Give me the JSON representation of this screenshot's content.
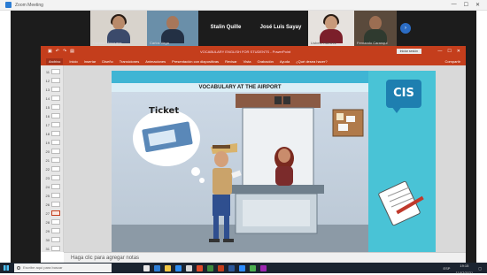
{
  "window": {
    "title": "Zoom Meeting"
  },
  "participants": [
    {
      "name": "Daniela Mosquera",
      "video": true,
      "shirt": "#3b4a6b"
    },
    {
      "name": "Carlos Vega",
      "video": true,
      "shirt": "#233044"
    },
    {
      "name": "Stalin Quille",
      "video": false
    },
    {
      "name": "José Luis Sayay",
      "video": false
    },
    {
      "name": "Lisbeth Ramirez",
      "video": true,
      "shirt": "#7b1f2a"
    },
    {
      "name": "Fernando Caranqui",
      "video": true,
      "shirt": "#2f3a2f"
    }
  ],
  "more_button": "›",
  "powerpoint": {
    "doc_title": "VOCABULARY ENGLISH FOR STUDENTS - PowerPoint",
    "sign_in": "Iniciar sesión",
    "ribbon_tabs": [
      "Archivo",
      "Inicio",
      "Insertar",
      "Diseño",
      "Transiciones",
      "Animaciones",
      "Presentación con diapositivas",
      "Revisar",
      "Vista",
      "Grabación",
      "Ayuda",
      "¿Qué desea hacer?"
    ],
    "share_label": "Compartir",
    "slide_numbers": [
      "11",
      "12",
      "13",
      "14",
      "15",
      "16",
      "17",
      "18",
      "19",
      "20",
      "21",
      "22",
      "23",
      "24",
      "25",
      "26",
      "27",
      "28",
      "29",
      "30",
      "31"
    ],
    "selected_slide": "27",
    "slide_title": "VOCABULARY AT THE AIRPORT",
    "ticket_word": "Ticket",
    "logo_text": "CIS",
    "notes_placeholder": "Haga clic para agregar notas"
  },
  "taskbar": {
    "search_placeholder": "Escribe aquí para buscar",
    "tray_text": "ESP",
    "time": "19:15",
    "date": "11/07/2021"
  },
  "colors": {
    "ppt_accent": "#c43e1c",
    "slide_header": "#3fb5d4",
    "cis_panel": "#49c3d6",
    "zoom_blue": "#2b6cc4"
  }
}
